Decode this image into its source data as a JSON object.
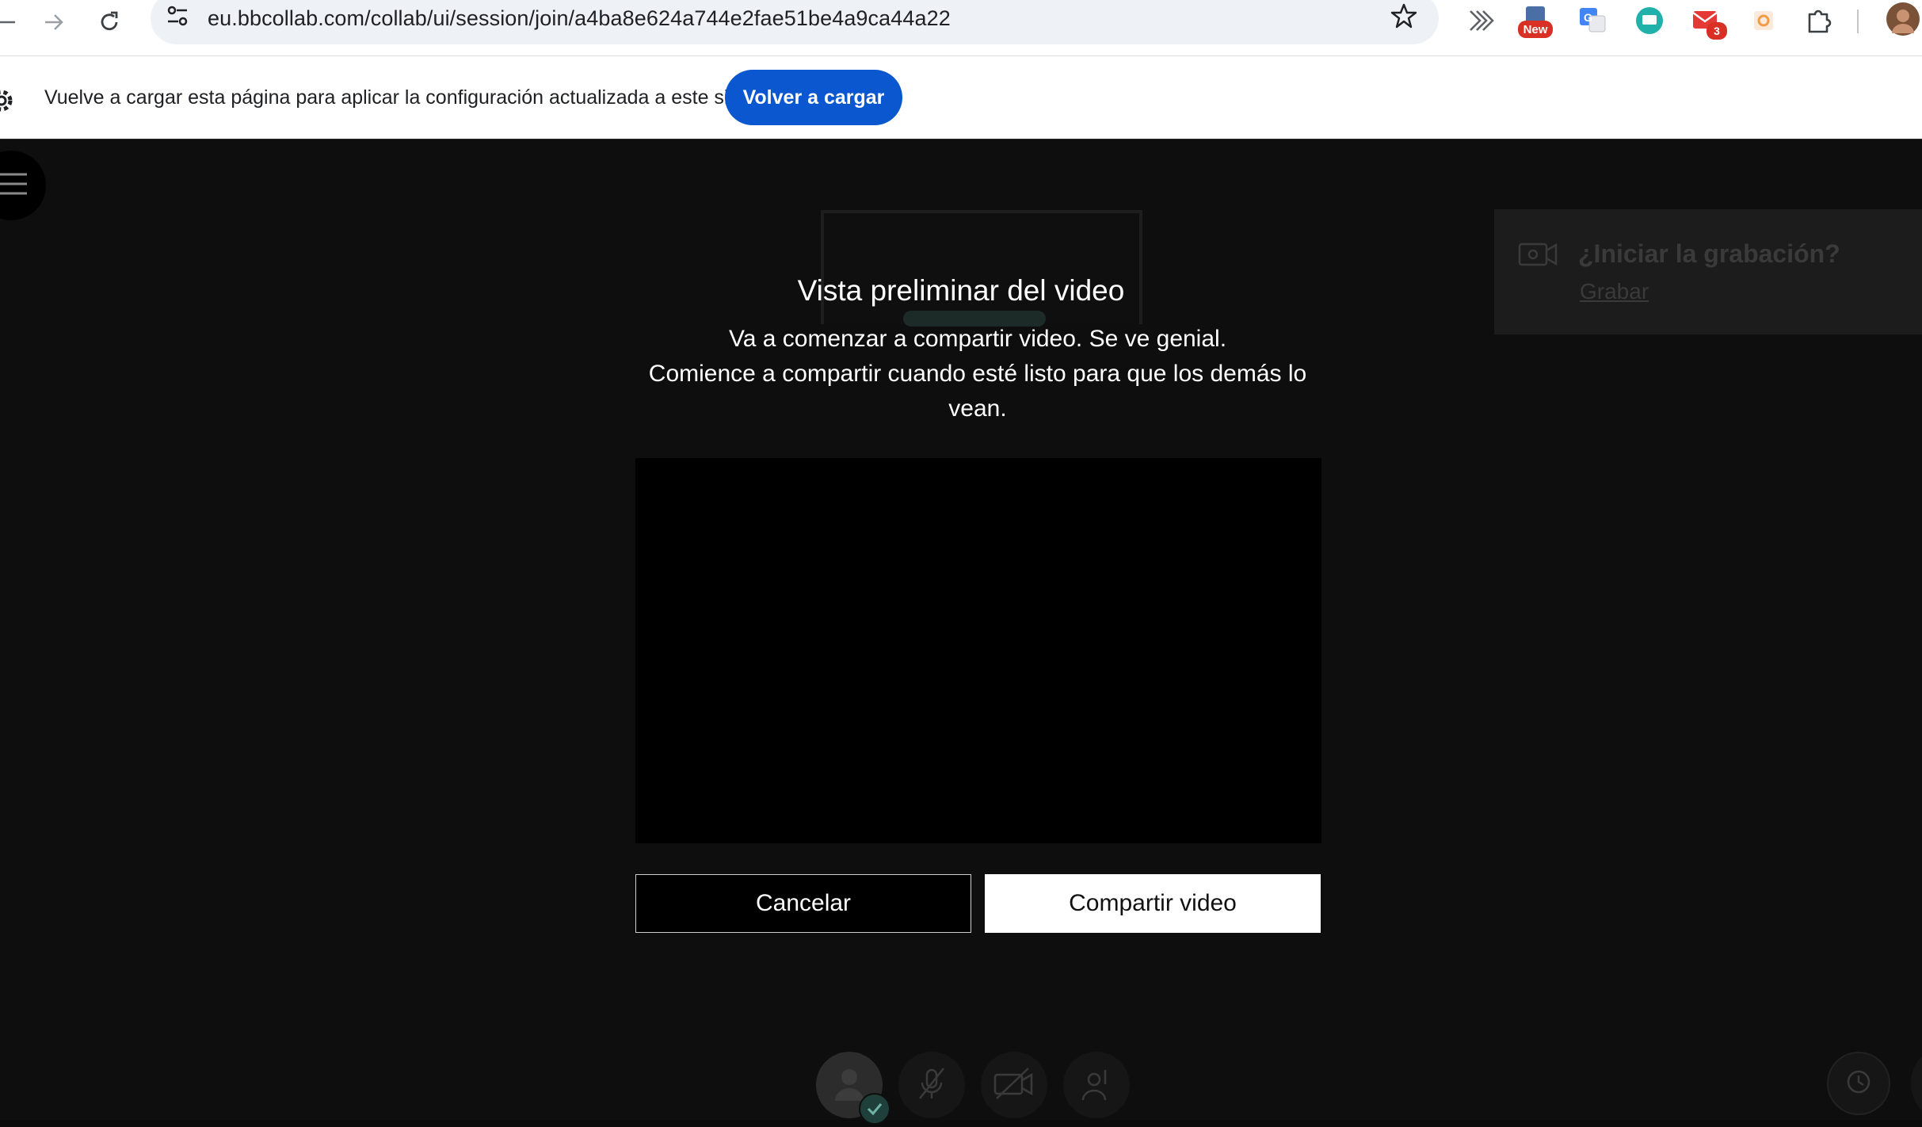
{
  "browser": {
    "url": "eu.bbcollab.com/collab/ui/session/join/a4ba8e624a744e2fae51be4a9ca44a22",
    "extensions": [
      {
        "name": "new-extension-icon",
        "badge": "New"
      },
      {
        "name": "google-translate-icon"
      },
      {
        "name": "screen-share-extension-icon"
      },
      {
        "name": "mail-extension-icon",
        "badge": "3"
      },
      {
        "name": "orange-extension-icon"
      },
      {
        "name": "puzzle-extensions-icon"
      }
    ]
  },
  "infobar": {
    "message": "Vuelve a cargar esta página para aplicar la configuración actualizada a este sitio",
    "reload_label": "Volver a cargar"
  },
  "recording": {
    "title": "¿Iniciar la grabación?",
    "link": "Grabar"
  },
  "dialog": {
    "title": "Vista preliminar del video",
    "line1": "Va a comenzar a compartir video. Se ve genial.",
    "line2": "Comience a compartir cuando esté listo para que los demás lo vean.",
    "cancel_label": "Cancelar",
    "share_label": "Compartir video"
  },
  "colors": {
    "accent": "#0b57d0",
    "app_background": "#0e0e0e"
  }
}
